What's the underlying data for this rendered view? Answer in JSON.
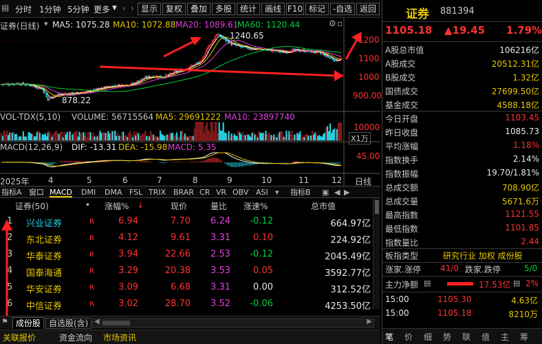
{
  "toolbar": {
    "items": [
      "分时",
      "1分钟",
      "5分钟",
      "更多"
    ],
    "buttons": [
      "显示",
      "复权",
      "叠加",
      "多股",
      "统计",
      "画线",
      "F10",
      "标记",
      "-自选",
      "返回"
    ]
  },
  "chart": {
    "name": "证券(日线)",
    "ma5_label": "MA5: 1075.28",
    "ma10_label": "MA10: 1072.88",
    "ma20_label": "MA20: 1089.61",
    "ma60_label": "MA60: 1120.44",
    "high_label": "1240.65",
    "low_label": "878.22",
    "y_ticks": [
      "1200",
      "1100",
      "1000",
      "900.00"
    ],
    "vol_label": "VOL-TDX(5,10)",
    "volume": "VOLUME: 56715564",
    "vol_ma5": "MA5: 29691222",
    "vol_ma10": "MA10: 23897740",
    "vol_tick": "10000",
    "vol_unit": "X1万",
    "macd_label": "MACD(12,26,9)",
    "dif": "DIF: -13.31",
    "dea": "DEA: -15.98",
    "macd": "MACD: 5.35",
    "macd_tick": "45.00",
    "year": "2025年",
    "months": [
      "4",
      "5",
      "6",
      "7",
      "8",
      "9",
      "10",
      "11",
      "12"
    ],
    "period": "日线",
    "colors": {
      "up": "#ff3232",
      "down": "#26d0e0",
      "ma5": "#ffffff",
      "ma10": "#e6c800",
      "ma20": "#e040e0",
      "ma60": "#00d23c"
    }
  },
  "indicator_tabs": [
    "指标A",
    "窗口",
    "MACD",
    "DMI",
    "DMA",
    "FSL",
    "TRIX",
    "BRAR",
    "CR",
    "VR",
    "OBV",
    "ASI",
    "指标B"
  ],
  "list": {
    "title": "证券(50)",
    "dot": "•",
    "headers": [
      "涨幅%",
      "现价",
      "量比",
      "涨速%",
      "总市值"
    ],
    "sort_mark": "↓",
    "rows": [
      {
        "idx": "1",
        "name": "兴业证券",
        "flag": "R",
        "change": "6.94",
        "price": "7.70",
        "vr": "6.24",
        "speed": "-0.12",
        "cap": "664.97亿"
      },
      {
        "idx": "2",
        "name": "东北证券",
        "flag": "R",
        "change": "4.12",
        "price": "9.61",
        "vr": "3.31",
        "speed": "0.10",
        "cap": "224.92亿"
      },
      {
        "idx": "3",
        "name": "华泰证券",
        "flag": "R",
        "change": "3.94",
        "price": "22.66",
        "vr": "2.53",
        "speed": "-0.12",
        "cap": "2045.49亿"
      },
      {
        "idx": "4",
        "name": "国泰海通",
        "flag": "R",
        "change": "3.29",
        "price": "20.38",
        "vr": "3.53",
        "speed": "0.05",
        "cap": "3592.77亿"
      },
      {
        "idx": "5",
        "name": "华安证券",
        "flag": "R",
        "change": "3.09",
        "price": "6.68",
        "vr": "3.31",
        "speed": "0.00",
        "cap": "312.52亿"
      },
      {
        "idx": "6",
        "name": "中信证券",
        "flag": "R",
        "change": "3.02",
        "price": "28.70",
        "vr": "3.52",
        "speed": "-0.06",
        "cap": "4253.50亿"
      }
    ]
  },
  "bottom_tabs": [
    "成份股",
    "自选股(含)"
  ],
  "status_tabs": [
    "关联报价",
    "资金流向",
    "市场资讯"
  ],
  "quote": {
    "name": "证券",
    "code": "881394",
    "price": "1105.18",
    "change": "▲19.45",
    "pct": "1.79%",
    "rows": [
      {
        "label": "A股总市值",
        "value": "106216亿",
        "cls": "white"
      },
      {
        "label": "A股成交",
        "value": "20512.31亿",
        "cls": "yellow"
      },
      {
        "label": "B股成交",
        "value": "1.32亿",
        "cls": "yellow"
      },
      {
        "label": "国债成交",
        "value": "27699.50亿",
        "cls": "yellow"
      },
      {
        "label": "基金成交",
        "value": "4588.18亿",
        "cls": "yellow"
      },
      {
        "label": "今日开盘",
        "value": "1103.45",
        "cls": "red"
      },
      {
        "label": "昨日收盘",
        "value": "1085.73",
        "cls": "white"
      },
      {
        "label": "平均涨幅",
        "value": "1.18%",
        "cls": "red"
      },
      {
        "label": "指数换手",
        "value": "2.14%",
        "cls": "white"
      },
      {
        "label": "指数振幅",
        "value": "19.70/1.81%",
        "cls": "white"
      },
      {
        "label": "总成交额",
        "value": "708.90亿",
        "cls": "yellow"
      },
      {
        "label": "总成交量",
        "value": "5671.6万",
        "cls": "yellow"
      },
      {
        "label": "最高指数",
        "value": "1121.55",
        "cls": "red"
      },
      {
        "label": "最低指数",
        "value": "1101.85",
        "cls": "red"
      },
      {
        "label": "指数量比",
        "value": "2.44",
        "cls": "red"
      }
    ],
    "board_type_label": "板指类型",
    "board_type_value": "研究行业 加权 成份股",
    "breadth_label": "涨家.涨停",
    "breadth_value": "41/0",
    "fall_label": "跌家.跌停",
    "fall_value": "5/0",
    "net_label": "主力净额",
    "net_value": "17.53亿",
    "net_pct": "2%",
    "ticks": [
      {
        "time": "15:00",
        "price": "1105.30",
        "vol": "4.63亿"
      },
      {
        "time": "15:00",
        "price": "1105.18",
        "vol": "8210万"
      }
    ],
    "bottom_icons": [
      "笔",
      "价",
      "细",
      "势",
      "联",
      "值",
      "主",
      "筹"
    ]
  }
}
